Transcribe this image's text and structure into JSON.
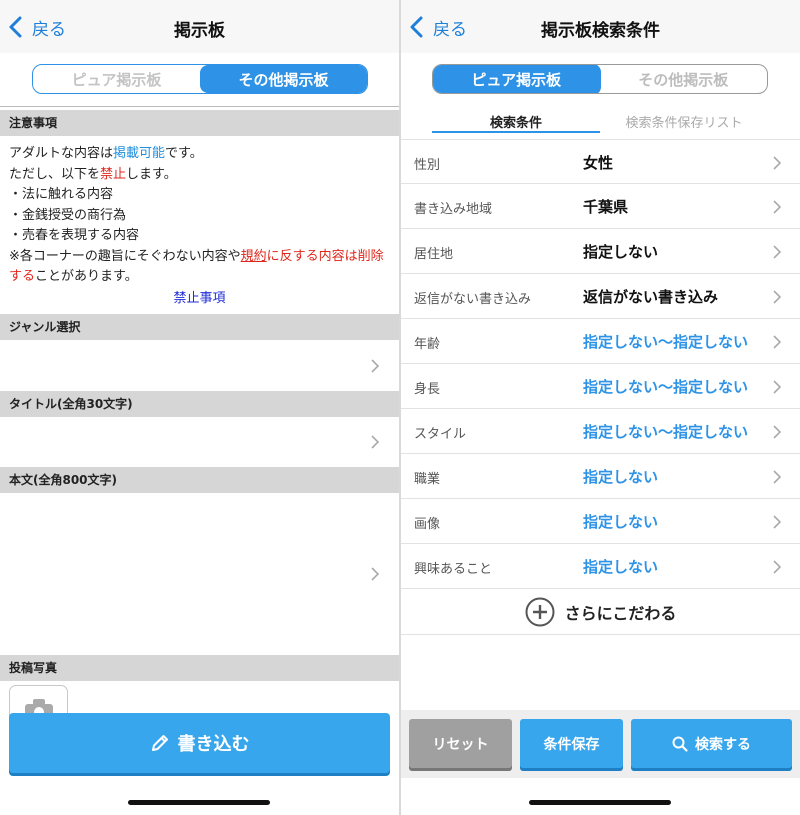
{
  "left": {
    "nav": {
      "back_label": "戻る",
      "title": "掲示板"
    },
    "segment": {
      "tab1": "ピュア掲示板",
      "tab2": "その他掲示板",
      "active": "tab2"
    },
    "notice": {
      "heading": "注意事項",
      "line1_pre": "アダルトな内容は",
      "line1_blue": "掲載可能",
      "line1_post": "です。",
      "line2_pre": "ただし、以下を",
      "line2_red": "禁止",
      "line2_post": "します。",
      "item1": "・法に触れる内容",
      "item2": "・金銭授受の商行為",
      "item3": "・売春を表現する内容",
      "line6_pre": "※各コーナーの趣旨にそぐわない内容や",
      "line6_red_u": "規約",
      "line6_red": "に反する内容は削除する",
      "line6_post": "ことがあります。",
      "ban_link": "禁止事項"
    },
    "genre": {
      "heading": "ジャンル選択"
    },
    "title_field": {
      "heading": "タイトル(全角30文字)"
    },
    "body_field": {
      "heading": "本文(全角800文字)"
    },
    "photo": {
      "heading": "投稿写真"
    },
    "write_button": "書き込む"
  },
  "right": {
    "nav": {
      "back_label": "戻る",
      "title": "掲示板検索条件"
    },
    "segment": {
      "tab1": "ピュア掲示板",
      "tab2": "その他掲示板",
      "active": "tab1"
    },
    "tabs": {
      "active": "検索条件",
      "inactive": "検索条件保存リスト"
    },
    "rows": [
      {
        "label": "性別",
        "value": "女性"
      },
      {
        "label": "書き込み地域",
        "value": "千葉県"
      },
      {
        "label": "居住地",
        "value": "指定しない"
      },
      {
        "label": "返信がない書き込み",
        "value": "返信がない書き込み"
      },
      {
        "label": "年齢",
        "value": "指定しない～指定しない"
      },
      {
        "label": "身長",
        "value": "指定しない～指定しない"
      },
      {
        "label": "スタイル",
        "value": "指定しない～指定しない"
      },
      {
        "label": "職業",
        "value": "指定しない"
      },
      {
        "label": "画像",
        "value": "指定しない"
      },
      {
        "label": "興味あること",
        "value": "指定しない"
      }
    ],
    "more": "さらにこだわる",
    "buttons": {
      "reset": "リセット",
      "save": "条件保存",
      "search": "検索する"
    }
  },
  "colors": {
    "accent": "#2e93e6",
    "button_blue": "#37a6ec",
    "red": "#e0261b",
    "link_blue": "#1e2bd6",
    "gray_button": "#a0a0a0"
  }
}
